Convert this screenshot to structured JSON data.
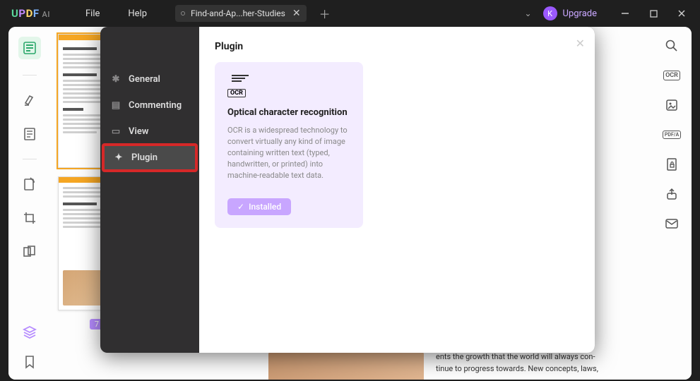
{
  "titlebar": {
    "logo": {
      "u": "U",
      "p": "P",
      "d": "D",
      "f": "F",
      "ai": "AI"
    },
    "menu": {
      "file": "File",
      "help": "Help"
    },
    "tab": {
      "title": "Find-and-Ap...her-Studies"
    },
    "upgrade": {
      "initial": "K",
      "label": "Upgrade"
    }
  },
  "thumbnails": {
    "page7": "7"
  },
  "settings": {
    "nav": {
      "general": "General",
      "commenting": "Commenting",
      "view": "View",
      "plugin": "Plugin"
    },
    "panel": {
      "title": "Plugin",
      "card": {
        "ocr_label": "OCR",
        "name": "Optical character recognition",
        "desc": "OCR is a widespread technology to convert virtually any kind of image containing written text (typed, handwritten, or printed) into machine-readable text data.",
        "installed": "Installed"
      }
    }
  },
  "right_icons": {
    "ocr": "OCR",
    "pdfa": "PDF/A"
  },
  "doc": {
    "line1": "ents the growth that the world will always con-",
    "line2": "tinue to progress towards. New concepts, laws,"
  }
}
